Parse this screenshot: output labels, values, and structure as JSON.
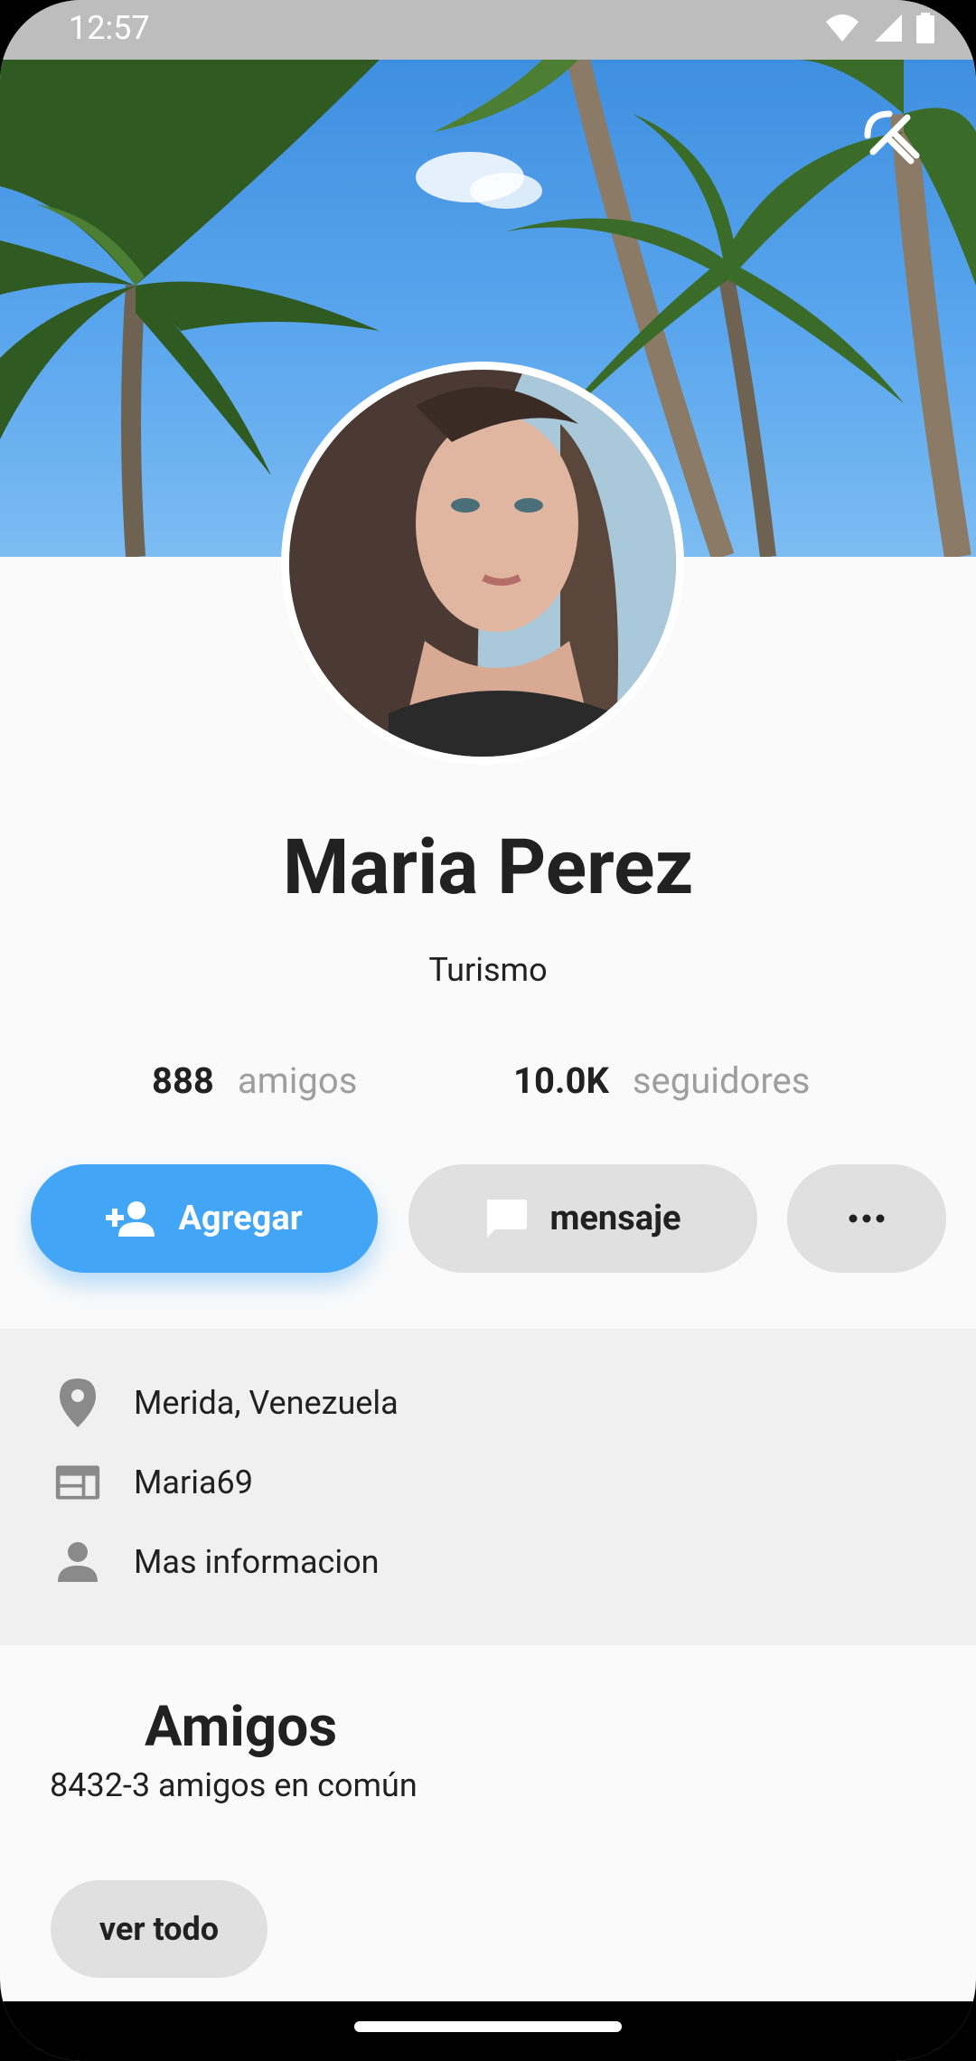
{
  "status_bar": {
    "time": "12:57"
  },
  "profile": {
    "name": "Maria Perez",
    "subtitle": "Turismo",
    "stats": [
      {
        "value": "888",
        "label": "amigos"
      },
      {
        "value": "10.0K",
        "label": "seguidores"
      }
    ]
  },
  "actions": {
    "add_label": "Agregar",
    "message_label": "mensaje"
  },
  "info": [
    {
      "icon": "location-pin-icon",
      "text": "Merida, Venezuela"
    },
    {
      "icon": "web-card-icon",
      "text": "Maria69"
    },
    {
      "icon": "person-icon",
      "text": "Mas informacion"
    }
  ],
  "friends": {
    "title": "Amigos",
    "subtitle": "8432-3 amigos en común",
    "see_all_label": "ver todo"
  },
  "colors": {
    "accent": "#42a5f5",
    "button_gray": "#e0e0e0",
    "status_bar": "#bdbdbd"
  }
}
